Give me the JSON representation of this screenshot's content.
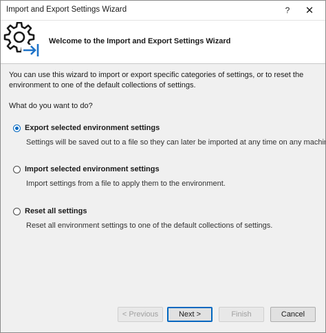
{
  "window": {
    "title": "Import and Export Settings Wizard",
    "help_label": "?",
    "close_label": "✕"
  },
  "header": {
    "title": "Welcome to the Import and Export Settings Wizard",
    "icon": "settings-export-icon"
  },
  "intro": {
    "text": "You can use this wizard to import or export specific categories of settings, or to reset the environment to one of the default collections of settings."
  },
  "question": "What do you want to do?",
  "options": [
    {
      "label": "Export selected environment settings",
      "description": "Settings will be saved out to a file so they can later be imported at any time on any machine.",
      "selected": true
    },
    {
      "label": "Import selected environment settings",
      "description": "Import settings from a file to apply them to the environment.",
      "selected": false
    },
    {
      "label": "Reset all settings",
      "description": "Reset all environment settings to one of the default collections of settings.",
      "selected": false
    }
  ],
  "buttons": {
    "previous": "< Previous",
    "next": "Next >",
    "finish": "Finish",
    "cancel": "Cancel"
  },
  "colors": {
    "accent": "#0067c0",
    "icon_arrow": "#1e73c8"
  }
}
